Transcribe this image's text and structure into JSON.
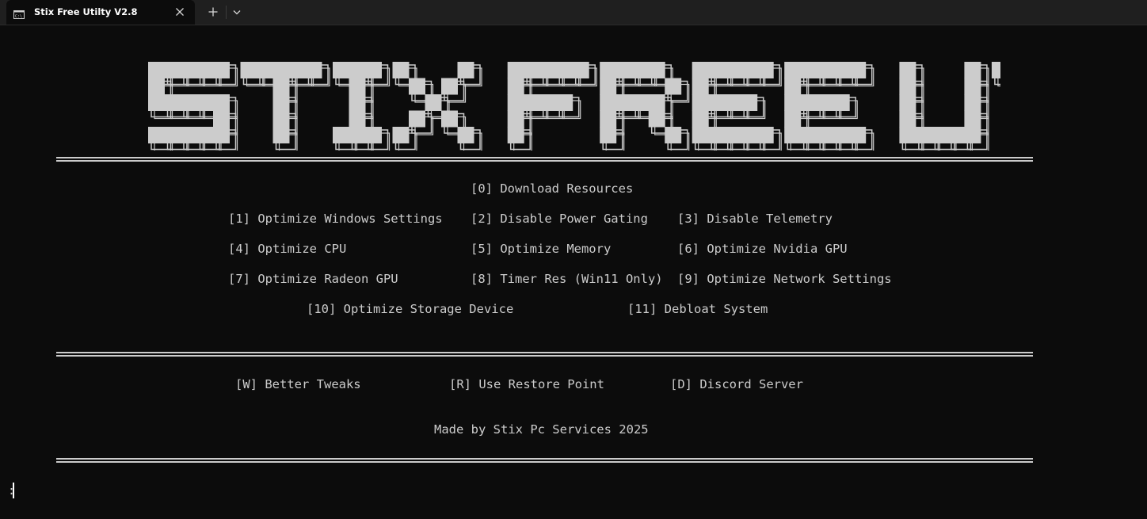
{
  "window": {
    "tab_title": "Stix Free Utilty V2.8",
    "tab_icon": "terminal-icon",
    "close_icon": "close-icon",
    "new_tab_icon": "plus-icon",
    "dropdown_icon": "chevron-down-icon"
  },
  "banner": {
    "text": "STIX FREE UTILITY"
  },
  "menu": {
    "download": "[0] Download Resources",
    "opt1": "[1] Optimize Windows Settings",
    "opt2": "[2] Disable Power Gating",
    "opt3": "[3] Disable Telemetry",
    "opt4": "[4] Optimize CPU",
    "opt5": "[5] Optimize Memory",
    "opt6": "[6] Optimize Nvidia GPU",
    "opt7": "[7] Optimize Radeon GPU",
    "opt8": "[8] Timer Res (Win11 Only)",
    "opt9": "[9] Optimize Network Settings",
    "opt10": "[10] Optimize Storage Device",
    "opt11": "[11] Debloat System"
  },
  "extras": {
    "better_tweaks": "[W] Better Tweaks",
    "restore_point": "[R] Use Restore Point",
    "discord": "[D] Discord Server"
  },
  "footer": {
    "credit": "Made by Stix Pc Services 2025"
  },
  "prompt": {
    "symbol": ":"
  },
  "colors": {
    "background": "#0c0c0c",
    "text": "#cccccc",
    "titlebar": "#1f1f1f"
  }
}
